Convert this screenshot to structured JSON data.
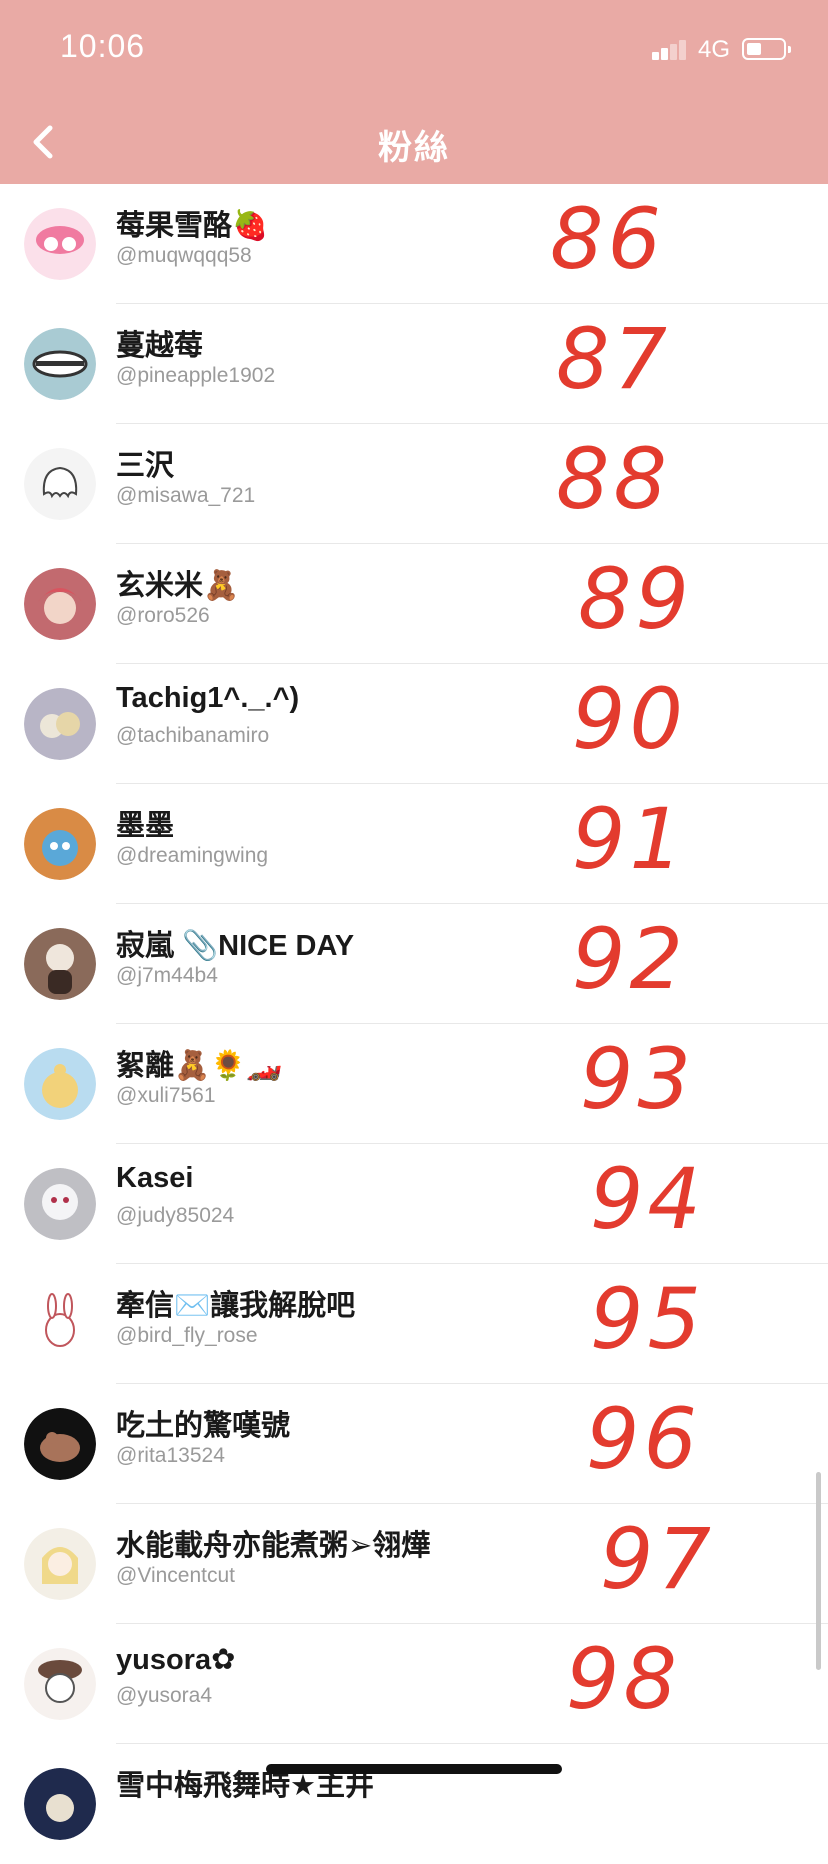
{
  "status_bar": {
    "time": "10:06",
    "network": "4G"
  },
  "nav": {
    "title": "粉絲"
  },
  "followers": [
    {
      "name": "莓果雪酪🍓",
      "handle": "@muqwqqq58",
      "handwritten": "86",
      "avatar_color": "#fbe0ea"
    },
    {
      "name": "蔓越莓",
      "handle": "@pineapple1902",
      "handwritten": "87",
      "avatar_color": "#a9cbd3"
    },
    {
      "name": "三沢",
      "handle": "@misawa_721",
      "handwritten": "88",
      "avatar_color": "#f4f4f4"
    },
    {
      "name": "玄米米🧸",
      "handle": "@roro526",
      "handwritten": "89",
      "avatar_color": "#c26a6f"
    },
    {
      "name": "Tachig1^._.^)",
      "handle": "@tachibanamiro",
      "handwritten": "90",
      "avatar_color": "#b8b5c6"
    },
    {
      "name": "墨墨",
      "handle": "@dreamingwing",
      "handwritten": "91",
      "avatar_color": "#d98b45"
    },
    {
      "name": "寂嵐 📎NICE DAY",
      "handle": "@j7m44b4",
      "handwritten": "92",
      "avatar_color": "#8a6a5a"
    },
    {
      "name": "絮離🧸🌻🏎️",
      "handle": "@xuli7561",
      "handwritten": "93",
      "avatar_color": "#b9dcf0"
    },
    {
      "name": "Kasei",
      "handle": "@judy85024",
      "handwritten": "94",
      "avatar_color": "#bfbfc4"
    },
    {
      "name": "牽信✉️讓我解脫吧",
      "handle": "@bird_fly_rose",
      "handwritten": "95",
      "avatar_color": "#ffffff"
    },
    {
      "name": "吃土的驚嘆號",
      "handle": "@rita13524",
      "handwritten": "96",
      "avatar_color": "#111111"
    },
    {
      "name": "水能載舟亦能煮粥➢翎燁",
      "handle": "@Vincentcut",
      "handwritten": "97",
      "avatar_color": "#f3efe6"
    },
    {
      "name": "yusora✿",
      "handle": "@yusora4",
      "handwritten": "98",
      "avatar_color": "#f6f1ee"
    },
    {
      "name": "雪中梅飛舞時★主井",
      "handle": "",
      "handwritten": "",
      "avatar_color": "#1f2a4d"
    }
  ],
  "colors": {
    "header": "#e9aaa5",
    "ink": "#e33b2e"
  }
}
